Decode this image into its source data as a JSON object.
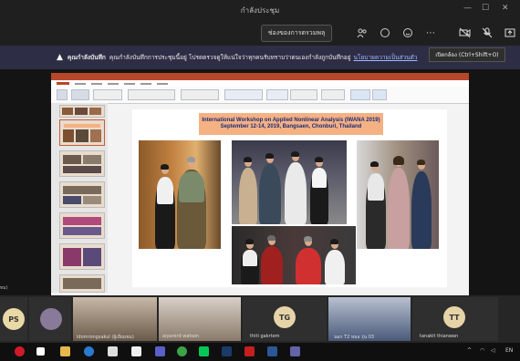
{
  "window": {
    "title": "กำลังประชุม"
  },
  "toolbar": {
    "share_tray": "ช่องของการตรวมพลุ",
    "icons": [
      "people-icon",
      "chat-icon",
      "reaction-icon",
      "more-icon",
      "camera-off-icon",
      "mic-off-icon",
      "share-icon"
    ]
  },
  "tooltip": {
    "text": "เปิดกล้อง (Ctrl+Shift+O)"
  },
  "banner": {
    "bold": "คุณกำลังบันทึก",
    "text": "คุณกำลังบันทึกการประชุมนี้อยู่ โปรดตรวจดูให้แน่ใจว่าทุกคนรับทราบว่าตนเองกำลังถูกบันทึกอยู่",
    "link": "นโยบายความเป็นส่วนตัว"
  },
  "slide": {
    "title_line1": "International Workshop on Applied Nonlinear Analysis (IWANA 2019)",
    "title_line2": "September 12-14, 2019, Bangsaen, Chonburi, Thailand"
  },
  "stage_label": "ทม)",
  "participants": [
    {
      "initials": "PS",
      "name": ""
    },
    {
      "initials": "",
      "name": ""
    },
    {
      "initials": "",
      "name": "ldomrongsakul (ผู้เยี่ยมชม)"
    },
    {
      "initials": "",
      "name": "aiyarerd watson"
    },
    {
      "initials": "TG",
      "name": "thiti gakrtem"
    },
    {
      "initials": "",
      "name": "นอก T2 หมอ รุ่น 03"
    },
    {
      "initials": "TT",
      "name": "tanakit thianwan"
    }
  ],
  "colors": {
    "accent_ppt": "#b7472a",
    "banner_bg": "#2d2d45",
    "slide_title_bg": "#f4b183",
    "slide_title_text": "#1d2b7a"
  },
  "taskbar": {
    "icons": [
      "opera-icon",
      "windows-icon",
      "file-explorer-icon",
      "edge-icon",
      "mail-icon",
      "file-icon",
      "teams-icon",
      "chrome-icon",
      "line-icon",
      "photoshop-icon",
      "acrobat-icon",
      "word-icon",
      "teams-icon"
    ],
    "lang": "EN"
  }
}
